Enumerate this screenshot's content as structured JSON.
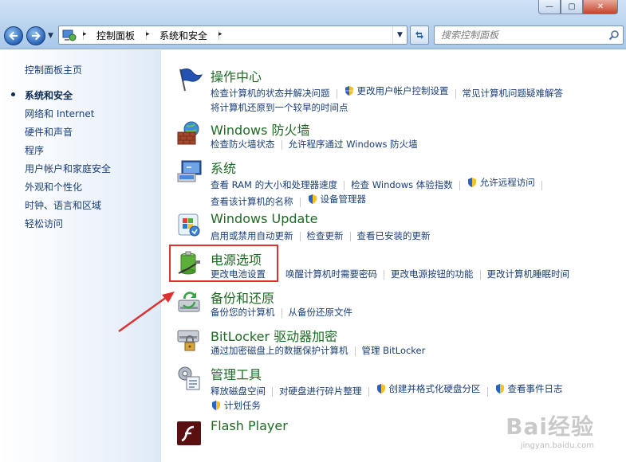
{
  "window": {
    "controls": {
      "minimize": "—",
      "maximize": "▢",
      "close": "✕"
    }
  },
  "address": {
    "breadcrumbs": [
      "控制面板",
      "系统和安全"
    ]
  },
  "search": {
    "placeholder": "搜索控制面板"
  },
  "sidebar": {
    "home": "控制面板主页",
    "items": [
      {
        "label": "系统和安全",
        "current": true
      },
      {
        "label": "网络和 Internet"
      },
      {
        "label": "硬件和声音"
      },
      {
        "label": "程序"
      },
      {
        "label": "用户帐户和家庭安全"
      },
      {
        "label": "外观和个性化"
      },
      {
        "label": "时钟、语言和区域"
      },
      {
        "label": "轻松访问"
      }
    ]
  },
  "categories": [
    {
      "title": "操作中心",
      "icon": "flag-icon",
      "links": [
        {
          "label": "检查计算机的状态并解决问题"
        },
        {
          "label": "更改用户帐户控制设置",
          "shield": true
        },
        {
          "label": "常见计算机问题疑难解答"
        },
        {
          "label": "将计算机还原到一个较早的时间点"
        }
      ]
    },
    {
      "title": "Windows 防火墙",
      "icon": "firewall-icon",
      "links": [
        {
          "label": "检查防火墙状态"
        },
        {
          "label": "允许程序通过 Windows 防火墙"
        }
      ]
    },
    {
      "title": "系统",
      "icon": "system-icon",
      "links": [
        {
          "label": "查看 RAM 的大小和处理器速度"
        },
        {
          "label": "检查 Windows 体验指数"
        },
        {
          "label": "允许远程访问",
          "shield": true
        },
        {
          "label": "查看该计算机的名称"
        },
        {
          "label": "设备管理器",
          "shield": true
        }
      ]
    },
    {
      "title": "Windows Update",
      "icon": "windows-update-icon",
      "links": [
        {
          "label": "启用或禁用自动更新"
        },
        {
          "label": "检查更新"
        },
        {
          "label": "查看已安装的更新"
        }
      ]
    },
    {
      "title": "电源选项",
      "icon": "battery-icon",
      "links": [
        {
          "label": "更改电池设置"
        },
        {
          "label": "唤醒计算机时需要密码"
        },
        {
          "label": "更改电源按钮的功能"
        },
        {
          "label": "更改计算机睡眠时间"
        }
      ]
    },
    {
      "title": "备份和还原",
      "icon": "backup-icon",
      "links": [
        {
          "label": "备份您的计算机"
        },
        {
          "label": "从备份还原文件"
        }
      ]
    },
    {
      "title": "BitLocker 驱动器加密",
      "icon": "bitlocker-icon",
      "links": [
        {
          "label": "通过加密磁盘上的数据保护计算机"
        },
        {
          "label": "管理 BitLocker"
        }
      ]
    },
    {
      "title": "管理工具",
      "icon": "admin-tools-icon",
      "links": [
        {
          "label": "释放磁盘空间"
        },
        {
          "label": "对硬盘进行碎片整理"
        },
        {
          "label": "创建并格式化硬盘分区",
          "shield": true
        },
        {
          "label": "查看事件日志",
          "shield": true
        },
        {
          "label": "计划任务",
          "shield": true
        }
      ]
    },
    {
      "title": "Flash Player",
      "icon": "flash-player-icon",
      "links": []
    }
  ],
  "watermark": {
    "brand": "Bai",
    "brand2": "经验",
    "url": "jingyan.baidu.com"
  }
}
